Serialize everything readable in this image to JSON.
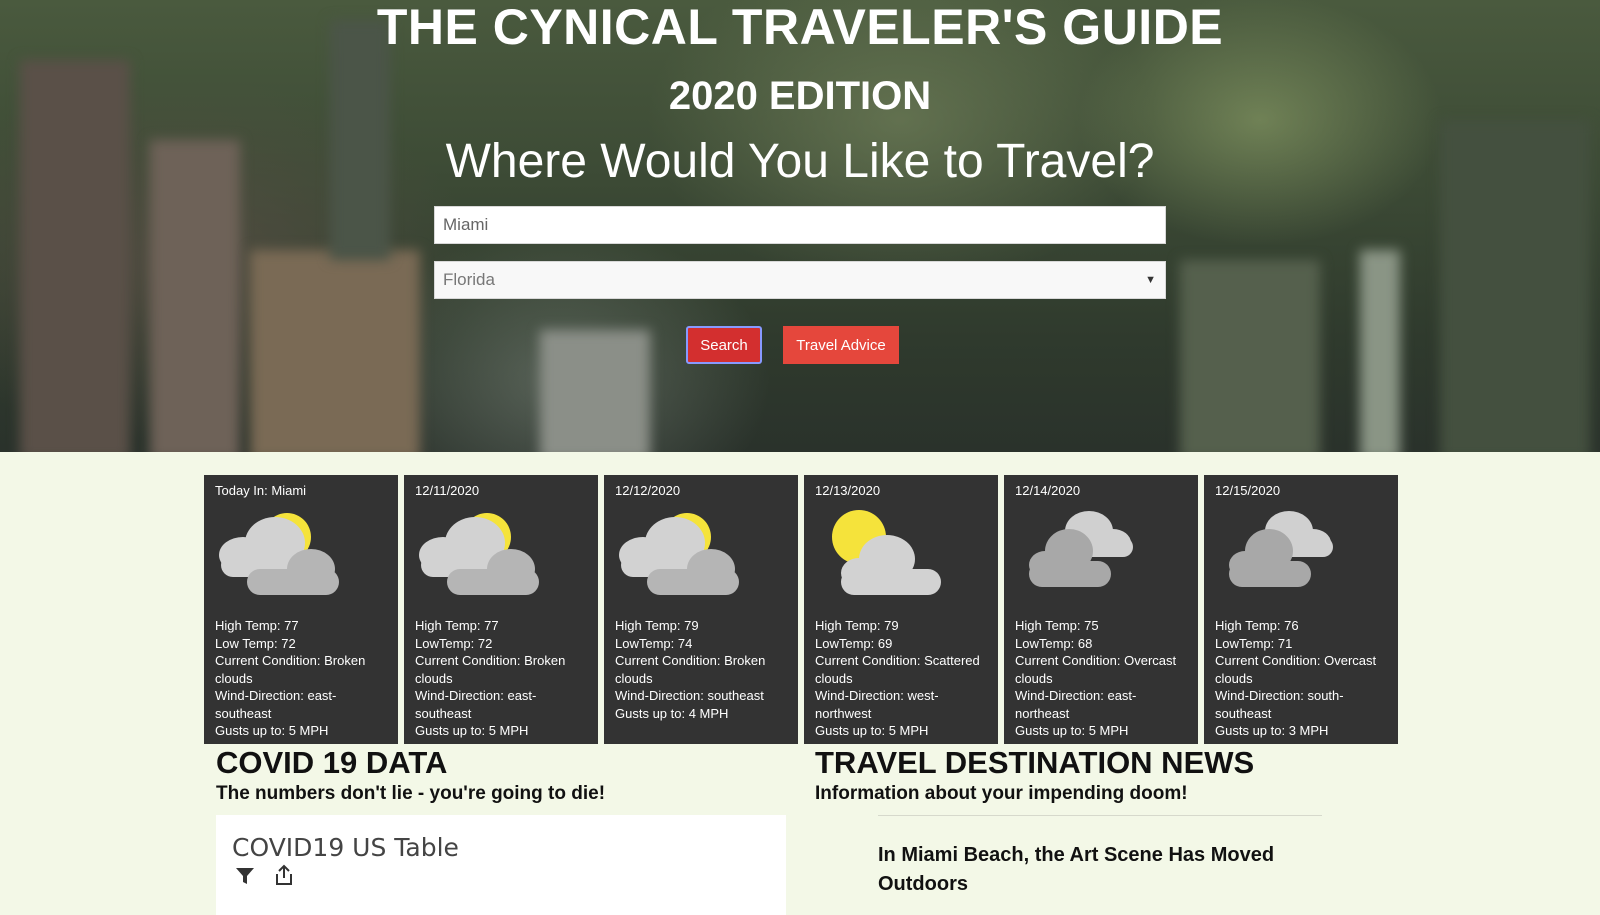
{
  "hero": {
    "title": "THE CYNICAL TRAVELER'S GUIDE",
    "edition": "2020 EDITION",
    "question": "Where Would You Like to Travel?",
    "city_input_value": "Miami",
    "state_select_value": "Florida",
    "search_label": "Search",
    "advice_label": "Travel Advice"
  },
  "forecast": [
    {
      "date": "Today In: Miami",
      "icon": "broken-clouds-icon",
      "high": "High Temp: 77",
      "low": "Low Temp: 72",
      "condition": "Current Condition: Broken clouds",
      "wind": "Wind-Direction: east-southeast",
      "gusts": "Gusts up to: 5 MPH"
    },
    {
      "date": "12/11/2020",
      "icon": "broken-clouds-icon",
      "high": "High Temp: 77",
      "low": "LowTemp: 72",
      "condition": "Current Condition: Broken clouds",
      "wind": "Wind-Direction: east-southeast",
      "gusts": "Gusts up to: 5 MPH"
    },
    {
      "date": "12/12/2020",
      "icon": "broken-clouds-icon",
      "high": "High Temp: 79",
      "low": "LowTemp: 74",
      "condition": "Current Condition: Broken clouds",
      "wind": "Wind-Direction: southeast",
      "gusts": "Gusts up to: 4 MPH"
    },
    {
      "date": "12/13/2020",
      "icon": "scattered-clouds-icon",
      "high": "High Temp: 79",
      "low": "LowTemp: 69",
      "condition": "Current Condition: Scattered clouds",
      "wind": "Wind-Direction: west-northwest",
      "gusts": "Gusts up to: 5 MPH"
    },
    {
      "date": "12/14/2020",
      "icon": "overcast-clouds-icon",
      "high": "High Temp: 75",
      "low": "LowTemp: 68",
      "condition": "Current Condition: Overcast clouds",
      "wind": "Wind-Direction: east-northeast",
      "gusts": "Gusts up to: 5 MPH"
    },
    {
      "date": "12/15/2020",
      "icon": "overcast-clouds-icon",
      "high": "High Temp: 76",
      "low": "LowTemp: 71",
      "condition": "Current Condition: Overcast clouds",
      "wind": "Wind-Direction: south-southeast",
      "gusts": "Gusts up to: 3 MPH"
    }
  ],
  "covid": {
    "title": "COVID 19 DATA",
    "subtitle": "The numbers don't lie - you're going to die!",
    "panel_title": "COVID19 US Table",
    "filter_icon": "filter-icon",
    "share_icon": "share-icon"
  },
  "news": {
    "title": "TRAVEL DESTINATION NEWS",
    "subtitle": "Information about your impending doom!",
    "headline": "In Miami Beach, the Art Scene Has Moved Outdoors"
  },
  "colors": {
    "page_bg": "#f3f8e7",
    "card_bg": "#333333",
    "search_button": "#d32f2f",
    "advice_button": "#e5473c",
    "sun": "#f5e33b"
  }
}
